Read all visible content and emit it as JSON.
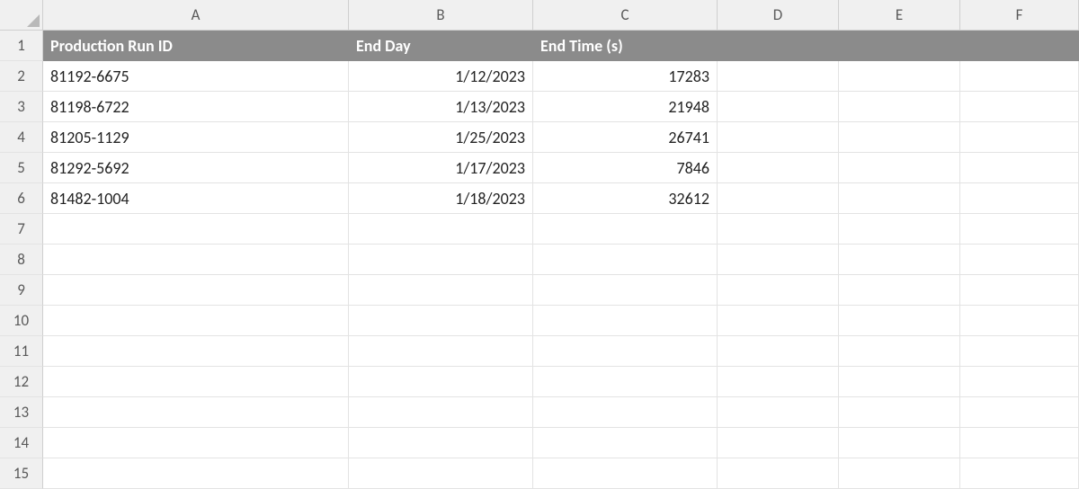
{
  "columns": [
    "A",
    "B",
    "C",
    "D",
    "E",
    "F"
  ],
  "rowCount": 15,
  "headers": {
    "A": "Production Run ID",
    "B": "End Day",
    "C": "End Time (s)",
    "D": "",
    "E": "",
    "F": ""
  },
  "rows": [
    {
      "id": "81192-6675",
      "day": "1/12/2023",
      "time": "17283"
    },
    {
      "id": "81198-6722",
      "day": "1/13/2023",
      "time": "21948"
    },
    {
      "id": "81205-1129",
      "day": "1/25/2023",
      "time": "26741"
    },
    {
      "id": "81292-5692",
      "day": "1/17/2023",
      "time": "7846"
    },
    {
      "id": "81482-1004",
      "day": "1/18/2023",
      "time": "32612"
    }
  ],
  "chart_data": {
    "type": "table",
    "columns": [
      "Production Run ID",
      "End Day",
      "End Time (s)"
    ],
    "data": [
      [
        "81192-6675",
        "1/12/2023",
        17283
      ],
      [
        "81198-6722",
        "1/13/2023",
        21948
      ],
      [
        "81205-1129",
        "1/25/2023",
        26741
      ],
      [
        "81292-5692",
        "1/17/2023",
        7846
      ],
      [
        "81482-1004",
        "1/18/2023",
        32612
      ]
    ]
  }
}
